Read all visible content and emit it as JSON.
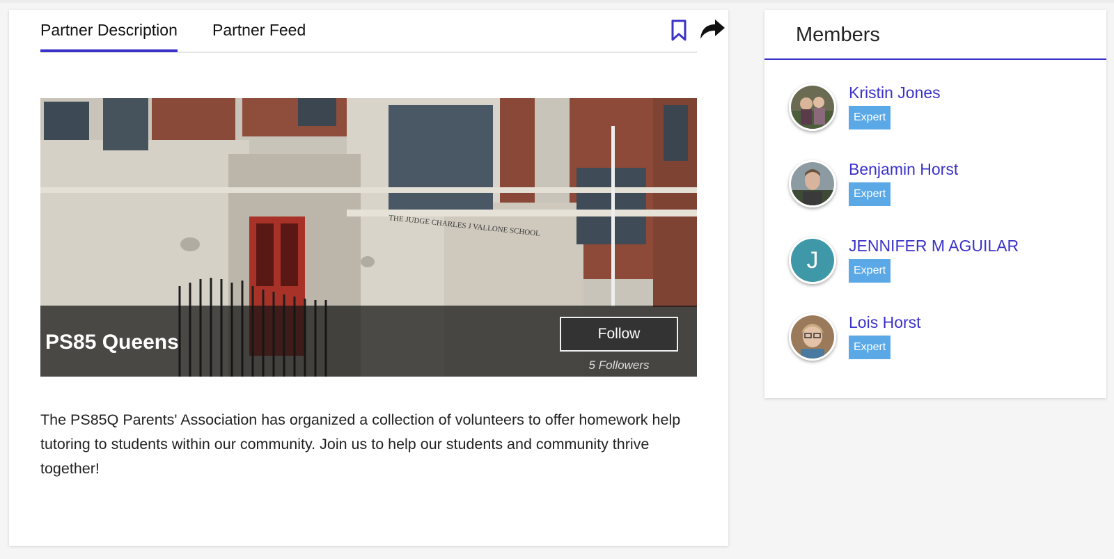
{
  "tabs": [
    {
      "label": "Partner Description",
      "active": true
    },
    {
      "label": "Partner Feed",
      "active": false
    }
  ],
  "icons": {
    "bookmark": "bookmark-icon",
    "share": "share-arrow-icon"
  },
  "accent_color": "#3b32c8",
  "hero": {
    "title": "PS85 Queens",
    "follow_label": "Follow",
    "followers": "5 Followers",
    "building_sign": "THE JUDGE CHARLES J VALLONE SCHOOL"
  },
  "description": "The PS85Q Parents' Association has organized a collection of volunteers to offer homework help tutoring to students within our community. Join us to help our students and community thrive together!",
  "members": {
    "title": "Members",
    "items": [
      {
        "name": "Kristin Jones",
        "badge": "Expert"
      },
      {
        "name": "Benjamin Horst",
        "badge": "Expert"
      },
      {
        "name": "JENNIFER M AGUILAR",
        "badge": "Expert",
        "initial": "J"
      },
      {
        "name": "Lois Horst",
        "badge": "Expert"
      }
    ]
  }
}
